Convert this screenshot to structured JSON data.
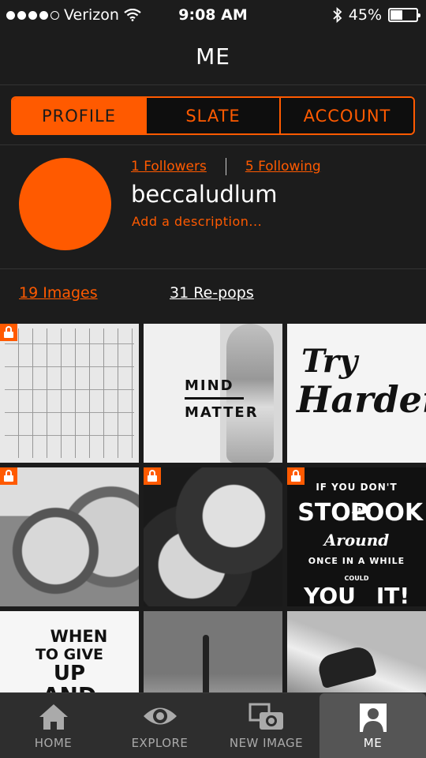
{
  "status_bar": {
    "carrier": "Verizon",
    "time": "9:08 AM",
    "battery": "45%",
    "battery_level": 0.45,
    "signal_bars": 4,
    "signal_total": 5
  },
  "header": {
    "title": "ME"
  },
  "segmented": {
    "tabs": [
      {
        "label": "PROFILE",
        "active": true
      },
      {
        "label": "SLATE",
        "active": false
      },
      {
        "label": "ACCOUNT",
        "active": false
      }
    ]
  },
  "profile": {
    "followers": "1 Followers",
    "following": "5 Following",
    "username": "beccaludlum",
    "description_placeholder": "Add a description...",
    "accent_color": "#ff5a00"
  },
  "counts": {
    "images": "19 Images",
    "repops": "31 Re-pops"
  },
  "grid": {
    "tiles": [
      {
        "name": "schedule-image",
        "locked": true
      },
      {
        "name": "mind-over-matter-image",
        "locked": false,
        "text": [
          "MIND",
          "MATTER"
        ]
      },
      {
        "name": "try-harder-image",
        "locked": false,
        "text": [
          "Try",
          "Harder"
        ]
      },
      {
        "name": "selfie-boy-image",
        "locked": true
      },
      {
        "name": "selfie-women-image",
        "locked": true
      },
      {
        "name": "stop-look-around-image",
        "locked": true,
        "text": [
          "IF YOU DON'T",
          "STOP",
          "AND",
          "LOOK",
          "Around",
          "ONCE IN A WHILE",
          "COULD",
          "YOU",
          "IT!"
        ]
      },
      {
        "name": "when-to-give-up-image",
        "locked": false,
        "text": [
          "WHEN",
          "TO GIVE",
          "UP",
          "AND"
        ]
      },
      {
        "name": "desert-cactus-image",
        "locked": false
      },
      {
        "name": "concert-image",
        "locked": false
      }
    ]
  },
  "tabbar": {
    "tabs": [
      {
        "label": "HOME",
        "icon": "home-icon",
        "active": false
      },
      {
        "label": "EXPLORE",
        "icon": "eye-icon",
        "active": false
      },
      {
        "label": "NEW IMAGE",
        "icon": "new-image-icon",
        "active": false
      },
      {
        "label": "ME",
        "icon": "person-icon",
        "active": true
      }
    ]
  }
}
